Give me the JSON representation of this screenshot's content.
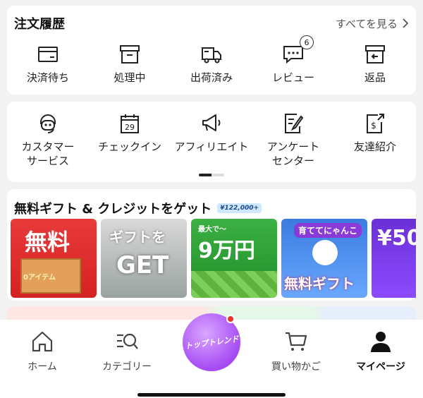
{
  "order_history": {
    "title": "注文履歴",
    "see_all": "すべてを見る",
    "items": [
      {
        "label": "決済待ち",
        "icon": "card-icon"
      },
      {
        "label": "処理中",
        "icon": "box-icon"
      },
      {
        "label": "出荷済み",
        "icon": "truck-icon"
      },
      {
        "label": "レビュー",
        "icon": "review-icon",
        "badge": "6"
      },
      {
        "label": "返品",
        "icon": "return-icon"
      }
    ]
  },
  "services": {
    "items": [
      {
        "label": "カスタマー\nサービス",
        "icon": "headset-icon"
      },
      {
        "label": "チェックイン",
        "icon": "calendar-icon",
        "icon_text": "29"
      },
      {
        "label": "アフィリエイト",
        "icon": "megaphone-icon"
      },
      {
        "label": "アンケート\nセンター",
        "icon": "survey-icon"
      },
      {
        "label": "友達紹介",
        "icon": "invite-icon",
        "icon_text": "$"
      }
    ]
  },
  "gifts": {
    "title": "無料ギフト & クレジットをゲット",
    "amount": "¥122,000+",
    "banners": [
      {
        "text": "無料",
        "sub": "0アイテム"
      },
      {
        "text": "ギフトを",
        "sub": "GET"
      },
      {
        "text": "9万円",
        "sub": "最大で～"
      },
      {
        "text": "無料ギフト",
        "sub": "育ててにゃんこ"
      },
      {
        "text": "¥50"
      }
    ]
  },
  "tabbar": {
    "tabs": [
      {
        "label": "ホーム",
        "icon": "home-icon"
      },
      {
        "label": "カテゴリー",
        "icon": "category-search-icon"
      },
      {
        "label": "買い物かご",
        "icon": "cart-icon"
      },
      {
        "label": "マイページ",
        "icon": "person-icon",
        "active": true
      }
    ],
    "center": "トップトレンド"
  },
  "colors": {
    "accent": "#a64bf4",
    "notify": "#e8342f"
  }
}
